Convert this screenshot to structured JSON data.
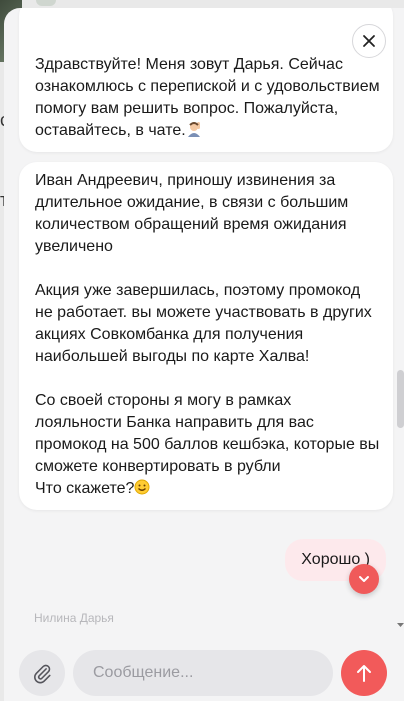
{
  "chat": {
    "messages": [
      {
        "from": "agent",
        "text": "Здравствуйте! Меня зовут Дарья. Сейчас ознакомлюсь с перепиской и с удовольствием помогу вам решить вопрос. Пожалуйста, оставайтесь, в чате.",
        "emoji": "person-raising-hand-emoji"
      },
      {
        "from": "agent",
        "text": "Иван Андреевич, приношу извинения за длительное ожидание, в связи с большим количеством обращений время ожидания увеличено\n\nАкция уже завершилась, поэтому промокод не работает. вы можете участвовать в других акциях Совкомбанка для получения наибольшей выгоды по карте Халва!\n\nСо своей стороны я могу в рамках лояльности Банка направить для вас промокод на 500 баллов кешбэка, которые вы сможете конвертировать в рубли\nЧто скажете?",
        "emoji": "smiley-emoji"
      },
      {
        "from": "user",
        "text": "Хорошо )"
      }
    ],
    "agent_name": "Нилина Дарья"
  },
  "composer": {
    "placeholder": "Сообщение..."
  },
  "icons": {
    "close": "close-icon",
    "attach": "paperclip-icon",
    "send": "arrow-up-icon",
    "scroll_down": "chevron-down-icon"
  },
  "colors": {
    "accent": "#f25a5a",
    "user_bubble": "#fde9ec",
    "agent_bubble": "#ffffff",
    "panel": "#f4f4f5"
  }
}
